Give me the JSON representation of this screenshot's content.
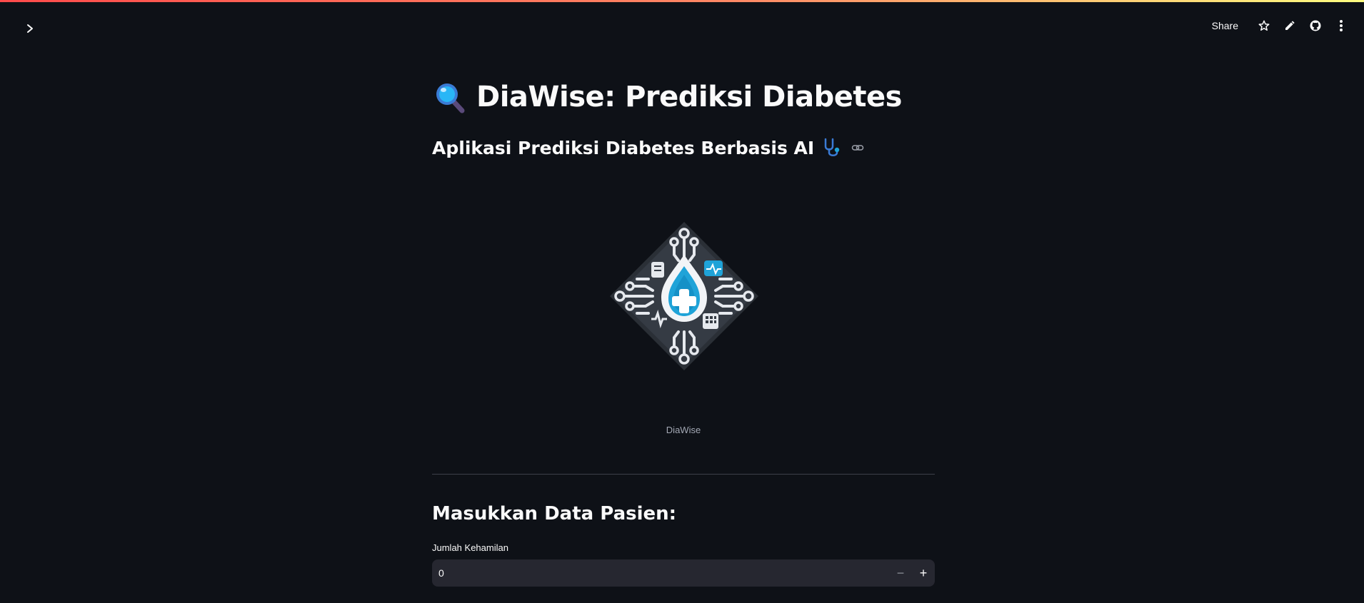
{
  "header": {
    "share_label": "Share",
    "icons": [
      "chevron-right-icon",
      "star-icon",
      "edit-icon",
      "github-icon",
      "more-vertical-icon"
    ]
  },
  "colors": {
    "background": "#0e1117",
    "input_background": "#262730",
    "accent_gradient": [
      "#ff4b4b",
      "#fffd80"
    ],
    "logo_blue": "#1fa3d8"
  },
  "main": {
    "title": "DiaWise: Prediksi Diabetes",
    "subtitle": "Aplikasi Prediksi Diabetes Berbasis AI",
    "logo_caption": "DiaWise",
    "section_title": "Masukkan Data Pasien:",
    "fields": [
      {
        "label": "Jumlah Kehamilan",
        "value": "0",
        "minus": "−",
        "plus": "+"
      }
    ]
  }
}
